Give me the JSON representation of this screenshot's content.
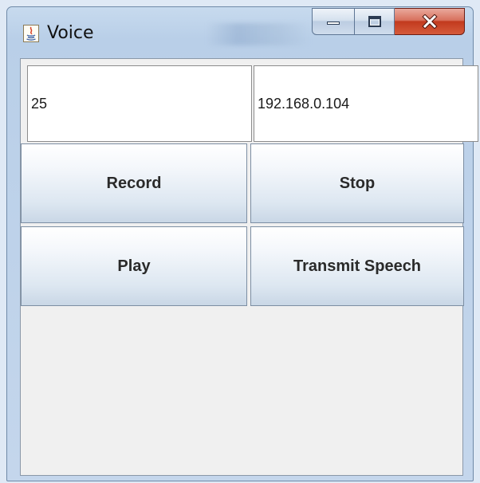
{
  "window": {
    "title": "Voice"
  },
  "titlebar_buttons": {
    "minimize_icon": "minimize-icon",
    "maximize_icon": "maximize-icon",
    "close_icon": "close-icon",
    "close_color": "#c23a1e"
  },
  "fields": {
    "port_value": "25",
    "ip_value": "192.168.0.104"
  },
  "buttons": {
    "record_label": "Record",
    "stop_label": "Stop",
    "play_label": "Play",
    "transmit_label": "Transmit Speech"
  }
}
